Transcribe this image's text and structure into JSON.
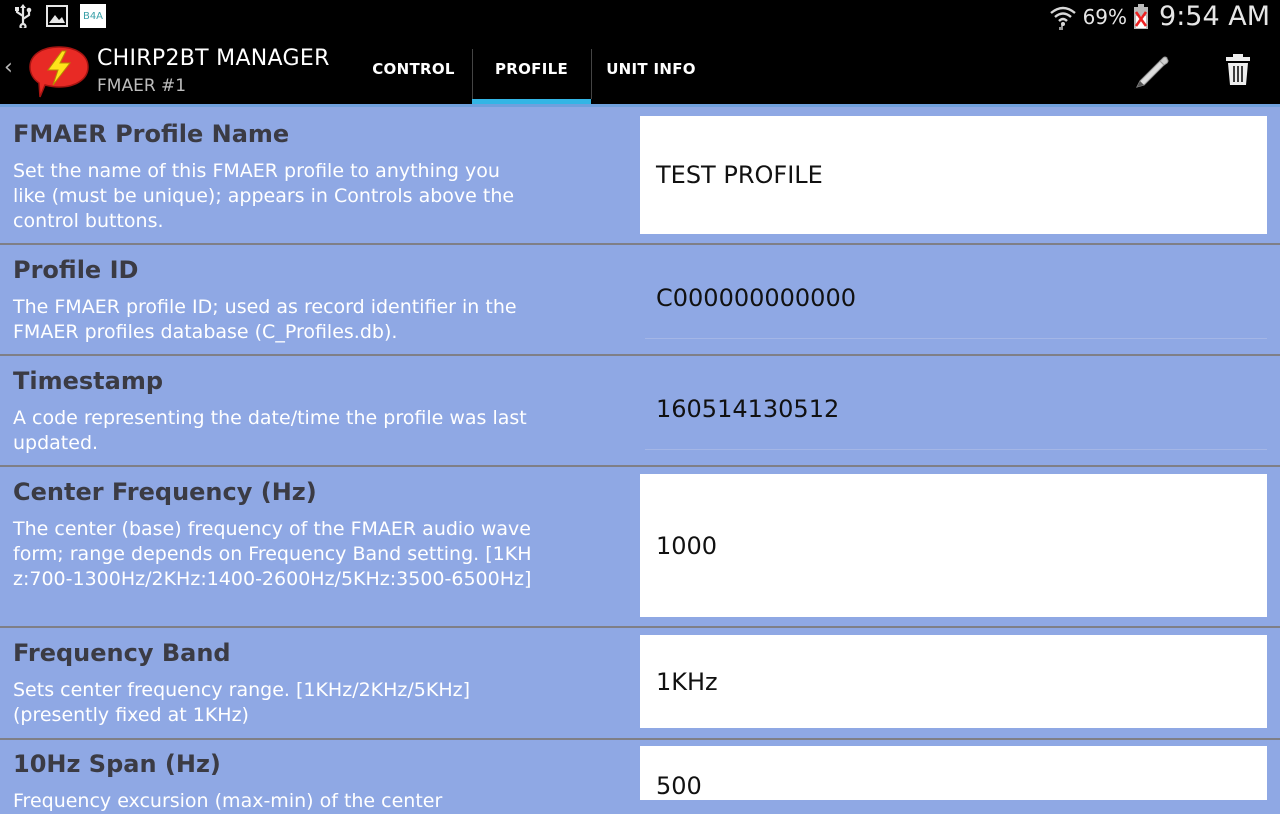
{
  "status_bar": {
    "icons": [
      "usb-icon",
      "image-icon",
      "b4a-icon",
      "wifi-icon",
      "battery-icon"
    ],
    "b4a_label": "B4A",
    "battery_pct": "69%",
    "time": "9:54 AM"
  },
  "action_bar": {
    "title": "CHIRP2BT MANAGER",
    "subtitle": "FMAER #1",
    "tabs": [
      {
        "label": "CONTROL",
        "selected": false
      },
      {
        "label": "PROFILE",
        "selected": true
      },
      {
        "label": "UNIT INFO",
        "selected": false
      }
    ],
    "actions": [
      "edit-pencil-icon",
      "trash-icon"
    ]
  },
  "rows": [
    {
      "title": "FMAER Profile Name",
      "description": "Set the name of this FMAER profile to anything you like (must be unique); appears in Controls above the control buttons.",
      "value": "TEST PROFILE",
      "editable": true
    },
    {
      "title": "Profile ID",
      "description": "The FMAER profile ID; used as record identifier in the FMAER profiles database (C_Profiles.db).",
      "value": "C000000000000",
      "editable": false
    },
    {
      "title": "Timestamp",
      "description": "A code representing the date/time the profile was last updated.",
      "value": "160514130512",
      "editable": false
    },
    {
      "title": "Center Frequency (Hz)",
      "description": "The center (base) frequency of the FMAER audio waveform; range depends on Frequency Band setting. [1KHz:700-1300Hz/2KHz:1400-2600Hz/5KHz:3500-6500Hz]",
      "value": "1000",
      "editable": true
    },
    {
      "title": "Frequency Band",
      "description": "Sets center frequency range. [1KHz/2KHz/5KHz] (presently fixed at 1KHz)",
      "value": "1KHz",
      "editable": true
    },
    {
      "title": "10Hz Span (Hz)",
      "description": "Frequency excursion (max-min) of the center",
      "value": "500",
      "editable": true
    }
  ],
  "colors": {
    "background": "#8fa8e4",
    "tab_indicator": "#33b5e5",
    "title_text": "#3b3b44"
  }
}
